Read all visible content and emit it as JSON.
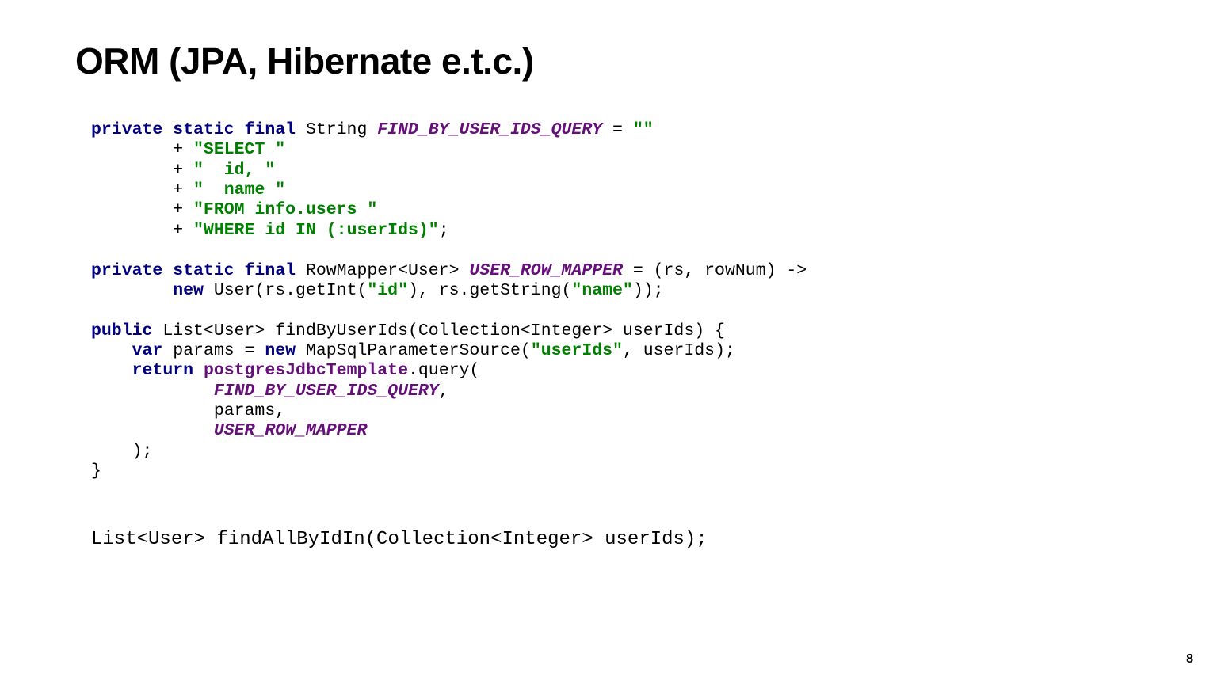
{
  "slide": {
    "title": "ORM (JPA, Hibernate e.t.c.)",
    "pageNumber": "8"
  },
  "code": {
    "l1_kw1": "private static final",
    "l1_type": " String ",
    "l1_const": "FIND_BY_USER_IDS_QUERY",
    "l1_rest": " = ",
    "l1_str": "\"\"",
    "l2_pre": "        + ",
    "l2_str": "\"SELECT \"",
    "l3_pre": "        + ",
    "l3_str": "\"  id, \"",
    "l4_pre": "        + ",
    "l4_str": "\"  name \"",
    "l5_pre": "        + ",
    "l5_str": "\"FROM info.users \"",
    "l6_pre": "        + ",
    "l6_str": "\"WHERE id IN (:userIds)\"",
    "l6_end": ";",
    "l8_kw1": "private static final",
    "l8_type": " RowMapper<User> ",
    "l8_const": "USER_ROW_MAPPER",
    "l8_rest": " = (rs, rowNum) ->",
    "l9_pre": "        ",
    "l9_kw": "new",
    "l9_a": " User(rs.getInt(",
    "l9_s1": "\"id\"",
    "l9_b": "), rs.getString(",
    "l9_s2": "\"name\"",
    "l9_c": "));",
    "l11_kw": "public",
    "l11_rest": " List<User> findByUserIds(Collection<Integer> userIds) {",
    "l12_pre": "    ",
    "l12_kw1": "var",
    "l12_a": " params = ",
    "l12_kw2": "new",
    "l12_b": " MapSqlParameterSource(",
    "l12_s": "\"userIds\"",
    "l12_c": ", userIds);",
    "l13_pre": "    ",
    "l13_kw": "return",
    "l13_sp": " ",
    "l13_field": "postgresJdbcTemplate",
    "l13_rest": ".query(",
    "l14_pre": "            ",
    "l14_const": "FIND_BY_USER_IDS_QUERY",
    "l14_end": ",",
    "l15": "            params,",
    "l16_pre": "            ",
    "l16_const": "USER_ROW_MAPPER",
    "l17": "    );",
    "l18": "}"
  },
  "signature": "List<User> findAllByIdIn(Collection<Integer> userIds);"
}
